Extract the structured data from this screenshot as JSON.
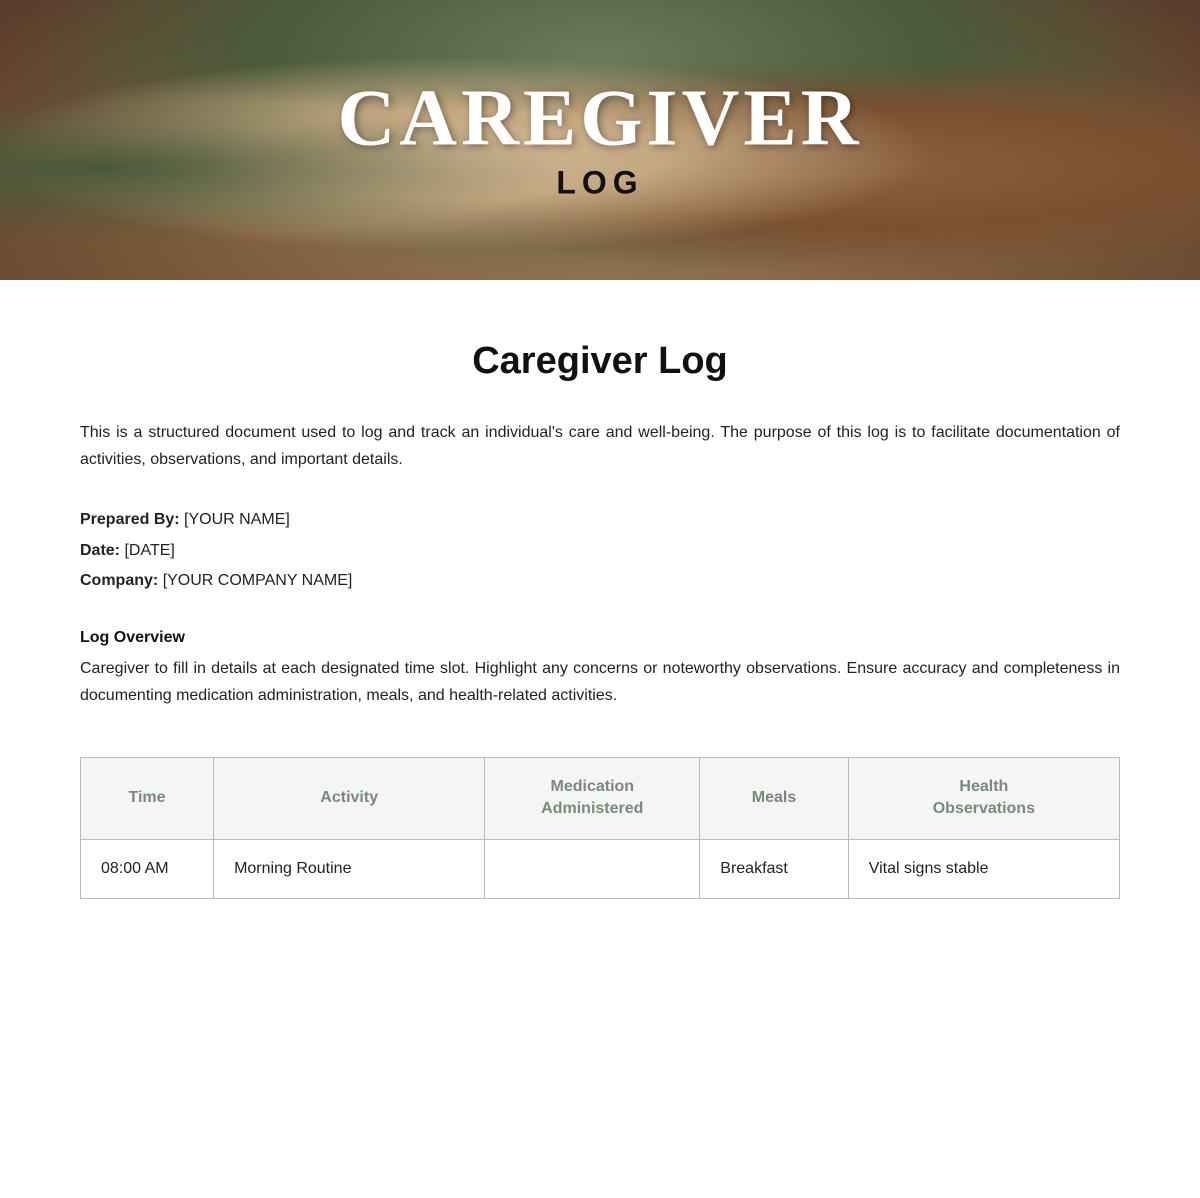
{
  "hero": {
    "title": "CAREGIVER",
    "subtitle": "LOG"
  },
  "document": {
    "title": "Caregiver Log",
    "intro": "This is a structured document used to log and track an individual's care and well-being. The purpose of this log is to facilitate documentation of activities, observations, and important details.",
    "prepared_by_label": "Prepared By:",
    "prepared_by_value": "[YOUR NAME]",
    "date_label": "Date:",
    "date_value": "[DATE]",
    "company_label": "Company:",
    "company_value": "[YOUR COMPANY NAME]",
    "overview_heading": "Log Overview",
    "overview_text": "Caregiver to fill in details at each designated time slot. Highlight any concerns or noteworthy observations. Ensure accuracy and completeness in documenting medication administration, meals, and health-related activities."
  },
  "table": {
    "headers": {
      "time": "Time",
      "activity": "Activity",
      "medication": "Medication Administered",
      "meals": "Meals",
      "health": "Health Observations"
    },
    "rows": [
      {
        "time": "08:00 AM",
        "activity": "Morning Routine",
        "medication": "",
        "meals": "Breakfast",
        "health": "Vital signs stable"
      }
    ]
  }
}
